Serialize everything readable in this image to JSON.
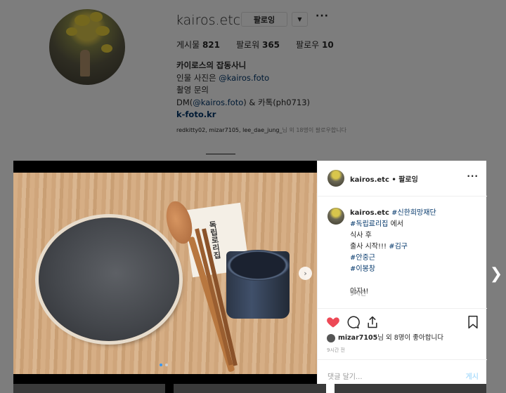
{
  "profile": {
    "username": "kairos.etc",
    "follow_label": "팔로잉",
    "dropdown_glyph": "▼",
    "more_glyph": "···",
    "stats": [
      {
        "label": "게시물",
        "value": "821"
      },
      {
        "label": "팔로워",
        "value": "365"
      },
      {
        "label": "팔로우",
        "value": "10"
      }
    ],
    "bio": {
      "name": "카이로스의 잡동사니",
      "line1_text": "인물 사진은 ",
      "line1_tag": "@kairos.foto",
      "line2": "촬영 문의",
      "line3_pre": "DM(",
      "line3_tag": "@kairos.foto",
      "line3_post": ") & 카톡(ph0713)",
      "link": "k-foto.kr"
    },
    "followed_by_users": "redkitty02, mizar7105, lee_dae_jung_",
    "followed_by_suffix": "님 외 18명이 팔로우합니다"
  },
  "post": {
    "napkin_text": "독립로리집",
    "header_user": "kairos.etc",
    "header_follow": "• 팔로잉",
    "more_glyph": "···",
    "caption": {
      "user": "kairos.etc",
      "tag1": "#신한희망재단",
      "tag2": "#독립료리집",
      "after_tag2": " 에서",
      "line3": "식사 후",
      "line4_text": "출사 시작!!! ",
      "tag3": "#김구",
      "tag4": "#안중근",
      "tag5": "#이봉창",
      "line_last": "아자!!"
    },
    "caption_time": "9시간",
    "likes_user": "mizar7105",
    "likes_suffix": "님 외 8명이 좋아합니다",
    "ago": "9시간 전",
    "comment_placeholder": "댓글 달기...",
    "post_label": "게시",
    "next_glyph": "›",
    "outer_next_glyph": "❯"
  },
  "colors": {
    "heart": "#ed4956",
    "link": "#003569",
    "post_button": "#b2dffc",
    "active_dot": "#3897f0"
  }
}
